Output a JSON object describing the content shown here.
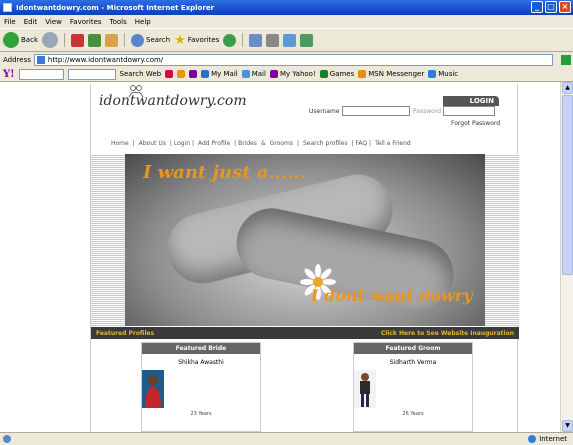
{
  "window": {
    "title": "Idontwantdowry.com - Microsoft Internet Explorer"
  },
  "menu": [
    "File",
    "Edit",
    "View",
    "Favorites",
    "Tools",
    "Help"
  ],
  "toolbar": {
    "back": "Back",
    "search": "Search",
    "favorites": "Favorites"
  },
  "address": {
    "label": "Address",
    "url": "http://www.idontwantdowry.com/"
  },
  "yahoo": {
    "logo": "Y!",
    "search_web": "Search Web",
    "my_mail": "My Mail",
    "mail": "Mail",
    "my_yahoo": "My Yahoo!",
    "games": "Games",
    "messenger": "MSN Messenger",
    "music": "Music"
  },
  "site": {
    "logo": "idontwantdowry.com",
    "username_label": "Username",
    "password_label": "Password",
    "login": "LOGIN",
    "forgot": "Forgot Password",
    "nav": [
      "Home",
      "|",
      "About Us",
      "| Login |",
      "Add Profile",
      "| Brides",
      "&",
      "Grooms",
      "|",
      "Search profiles",
      "| FAQ |",
      "Tell a Friend"
    ],
    "tagline1": "I want just a......",
    "tagline2": "I dont want dowry",
    "featured_profiles": "Featured Profiles",
    "website_inauguration": "Click Here to See Website Inauguration",
    "bride_head": "Featured Bride",
    "bride_name": "Shikha Awasthi",
    "bride_age": "23 Years",
    "groom_head": "Featured Groom",
    "groom_name": "Sidharth Verma",
    "groom_age": "26 Years"
  },
  "status": {
    "zone": "Internet"
  }
}
